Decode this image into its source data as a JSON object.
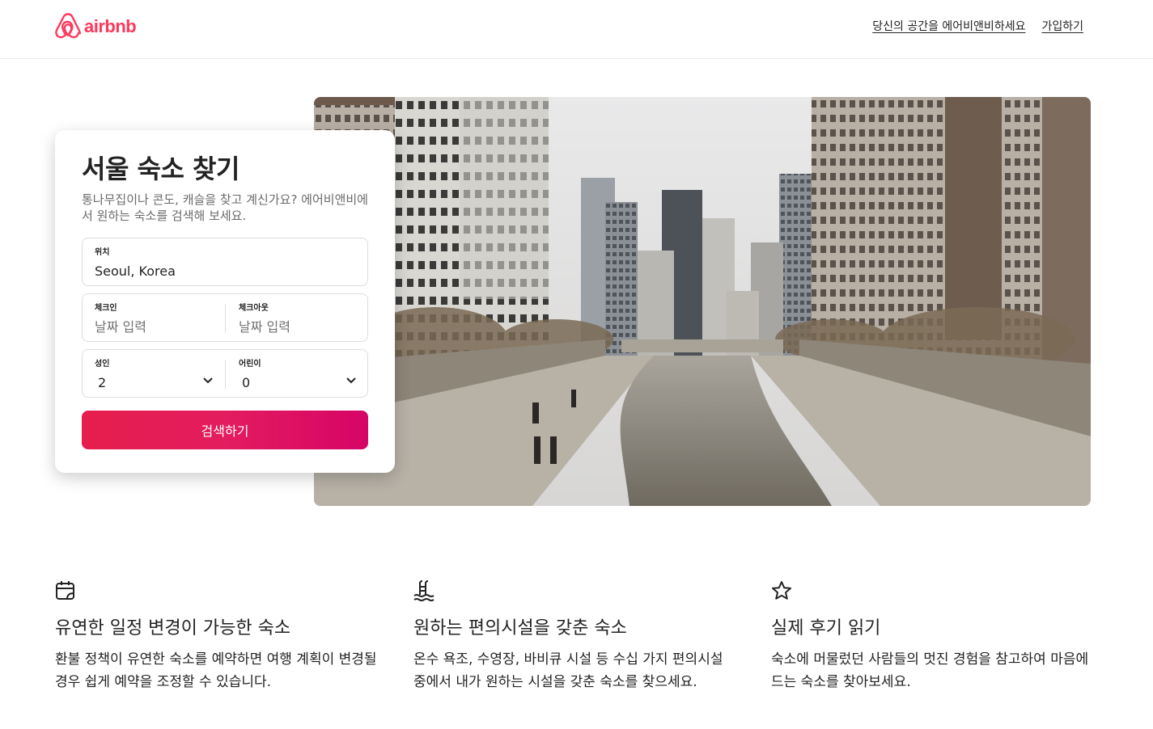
{
  "header": {
    "logo_text": "airbnb",
    "links": [
      "당신의 공간을 에어비앤비하세요",
      "가입하기"
    ]
  },
  "search_card": {
    "title": "서울 숙소 찾기",
    "description": "통나무집이나 콘도, 캐슬을 찾고 계신가요? 에어비앤비에서 원하는 숙소를 검색해 보세요.",
    "location": {
      "label": "위치",
      "value": "Seoul, Korea"
    },
    "checkin": {
      "label": "체크인",
      "placeholder": "날짜 입력"
    },
    "checkout": {
      "label": "체크아웃",
      "placeholder": "날짜 입력"
    },
    "adults": {
      "label": "성인",
      "value": "2"
    },
    "children": {
      "label": "어린이",
      "value": "0"
    },
    "search_button": "검색하기"
  },
  "features": [
    {
      "icon": "calendar-icon",
      "title": "유연한 일정 변경이 가능한 숙소",
      "description": "환불 정책이 유연한 숙소를 예약하면 여행 계획이 변경될 경우 쉽게 예약을 조정할 수 있습니다."
    },
    {
      "icon": "pool-icon",
      "title": "원하는 편의시설을 갖춘 숙소",
      "description": "온수 욕조, 수영장, 바비큐 시설 등 수십 가지 편의시설 중에서 내가 원하는 시설을 갖춘 숙소를 찾으세요."
    },
    {
      "icon": "star-icon",
      "title": "실제 후기 읽기",
      "description": "숙소에 머물렀던 사람들의 멋진 경험을 참고하여 마음에 드는 숙소를 찾아보세요."
    }
  ],
  "colors": {
    "brand": "#ff385c",
    "button_start": "#e61e4d",
    "button_end": "#d70466",
    "text": "#222222",
    "muted": "#717171"
  }
}
